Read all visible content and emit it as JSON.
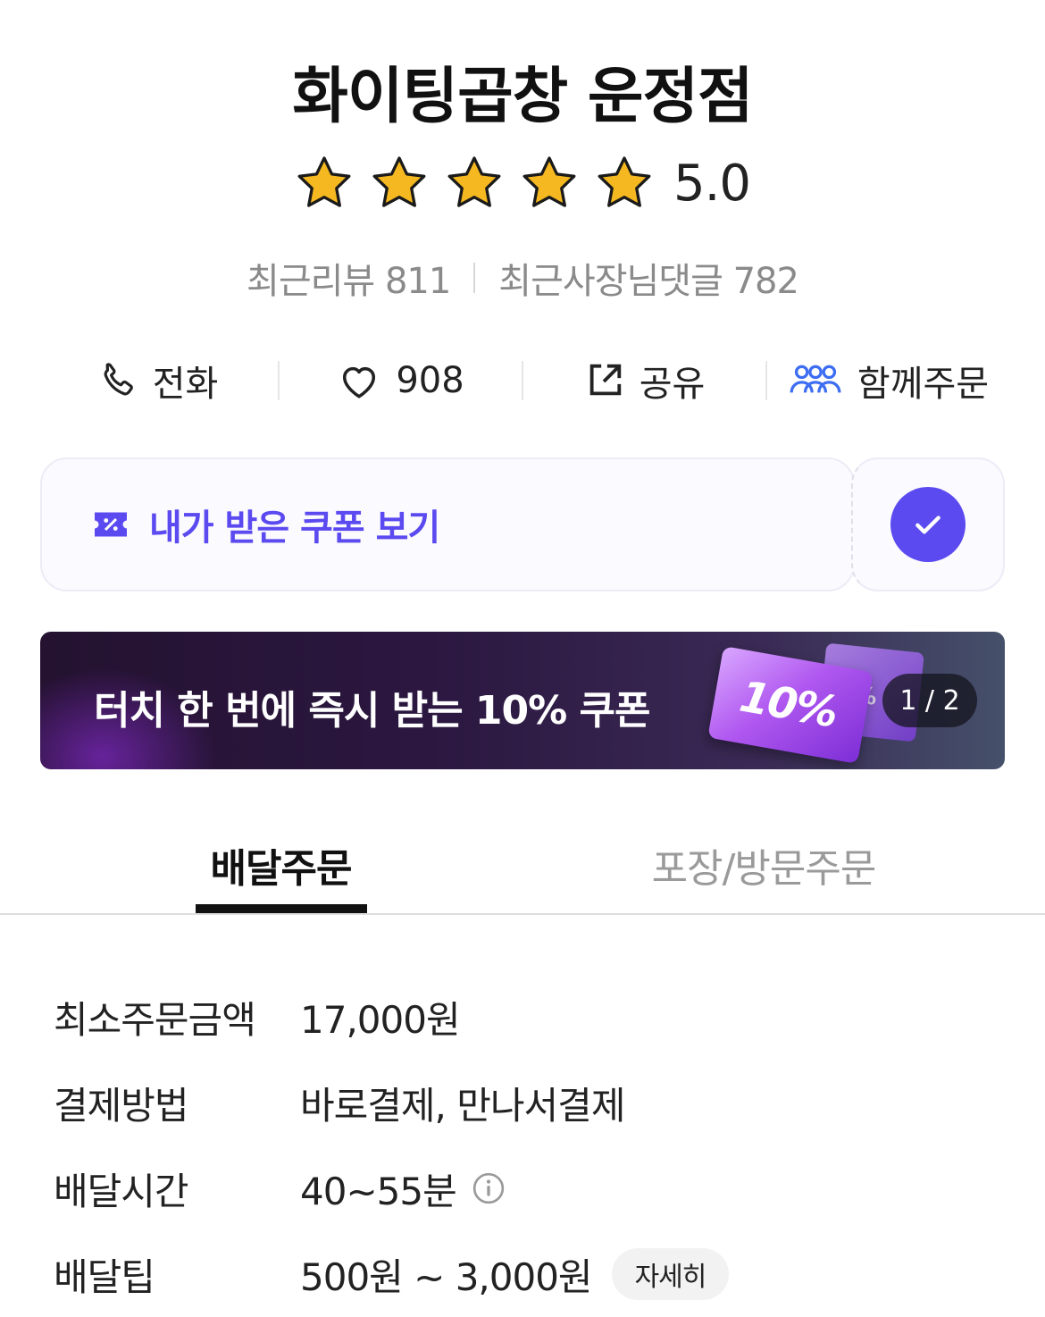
{
  "store": {
    "name": "화이팅곱창 운정점",
    "rating": "5.0",
    "rating_stars": 5,
    "recent_reviews": "최근리뷰 811",
    "owner_replies": "최근사장님댓글 782"
  },
  "actions": {
    "call_label": "전화",
    "like_count": "908",
    "share_label": "공유",
    "group_order_label": "함께주문"
  },
  "coupon": {
    "label": "내가 받은 쿠폰 보기"
  },
  "banner": {
    "text": "터치 한 번에 즉시 받는 10% 쿠폰",
    "ticket_text": "10%",
    "ticket_small": "%",
    "pager": "1 / 2"
  },
  "tabs": {
    "delivery": "배달주문",
    "pickup": "포장/방문주문"
  },
  "info": {
    "min_order_label": "최소주문금액",
    "min_order_value": "17,000원",
    "payment_label": "결제방법",
    "payment_value": "바로결제, 만나서결제",
    "delivery_time_label": "배달시간",
    "delivery_time_value": "40~55분",
    "delivery_tip_label": "배달팁",
    "delivery_tip_value": "500원 ~ 3,000원",
    "detail_button": "자세히"
  },
  "colors": {
    "accent": "#5b4af0",
    "star": "#f5b820",
    "group_order_icon": "#3d6df2"
  },
  "icons": [
    "phone-icon",
    "heart-icon",
    "share-icon",
    "group-order-icon",
    "coupon-icon",
    "check-icon",
    "info-icon",
    "star-icon"
  ]
}
